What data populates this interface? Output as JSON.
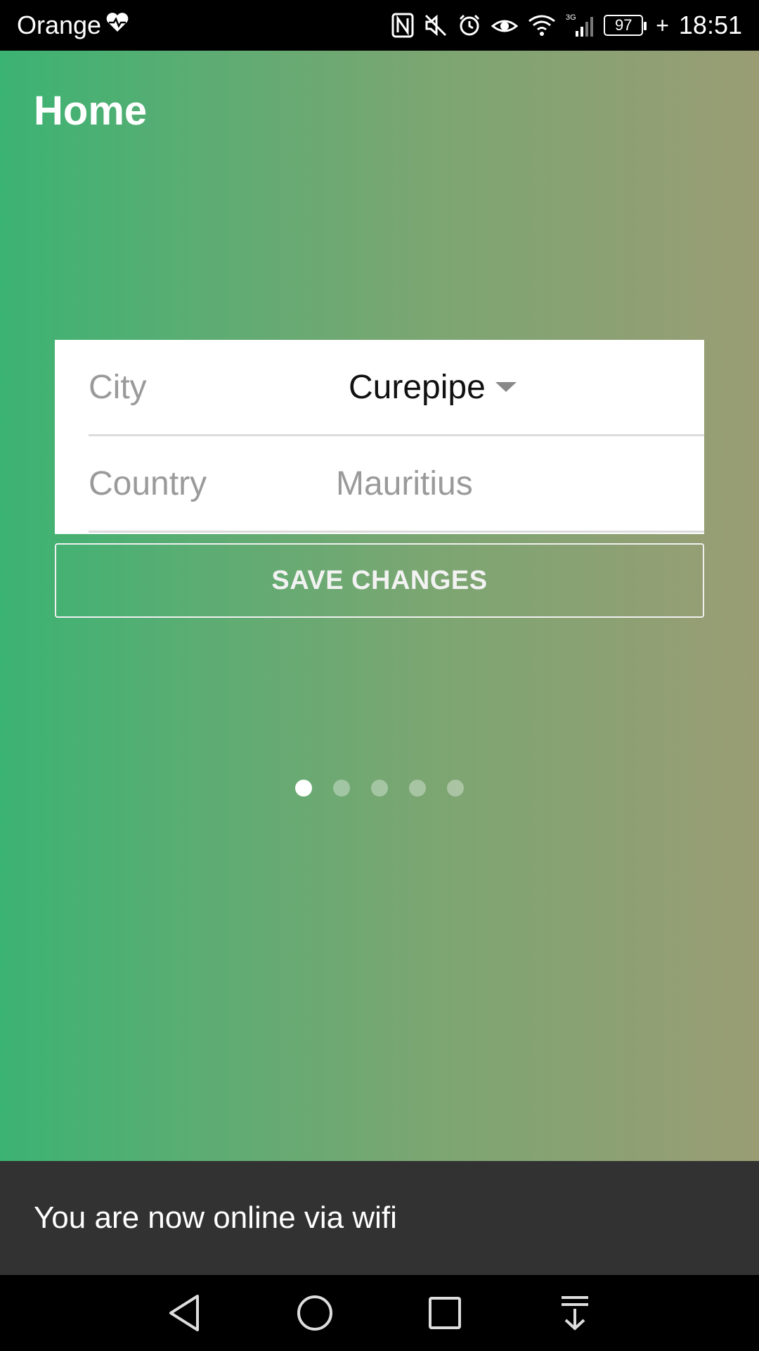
{
  "status_bar": {
    "carrier": "Orange",
    "battery": "97",
    "time": "18:51",
    "icons": [
      "heart-pulse-icon",
      "nfc-icon",
      "mute-icon",
      "alarm-icon",
      "eye-icon",
      "wifi-icon",
      "signal-3g-icon",
      "battery-icon",
      "charging-icon"
    ]
  },
  "header": {
    "title": "Home"
  },
  "form": {
    "city_label": "City",
    "city_value": "Curepipe",
    "country_label": "Country",
    "country_value": "Mauritius",
    "save_label": "SAVE CHANGES"
  },
  "pager": {
    "total": 5,
    "active_index": 0
  },
  "snackbar": {
    "message": "You are now online via wifi"
  },
  "colors": {
    "gradient_start": "#3bb373",
    "gradient_end": "#9a9d74",
    "snackbar_bg": "#323232"
  },
  "nav_bar": {
    "icons": [
      "back-icon",
      "home-icon",
      "recents-icon",
      "notification-pull-icon"
    ]
  }
}
